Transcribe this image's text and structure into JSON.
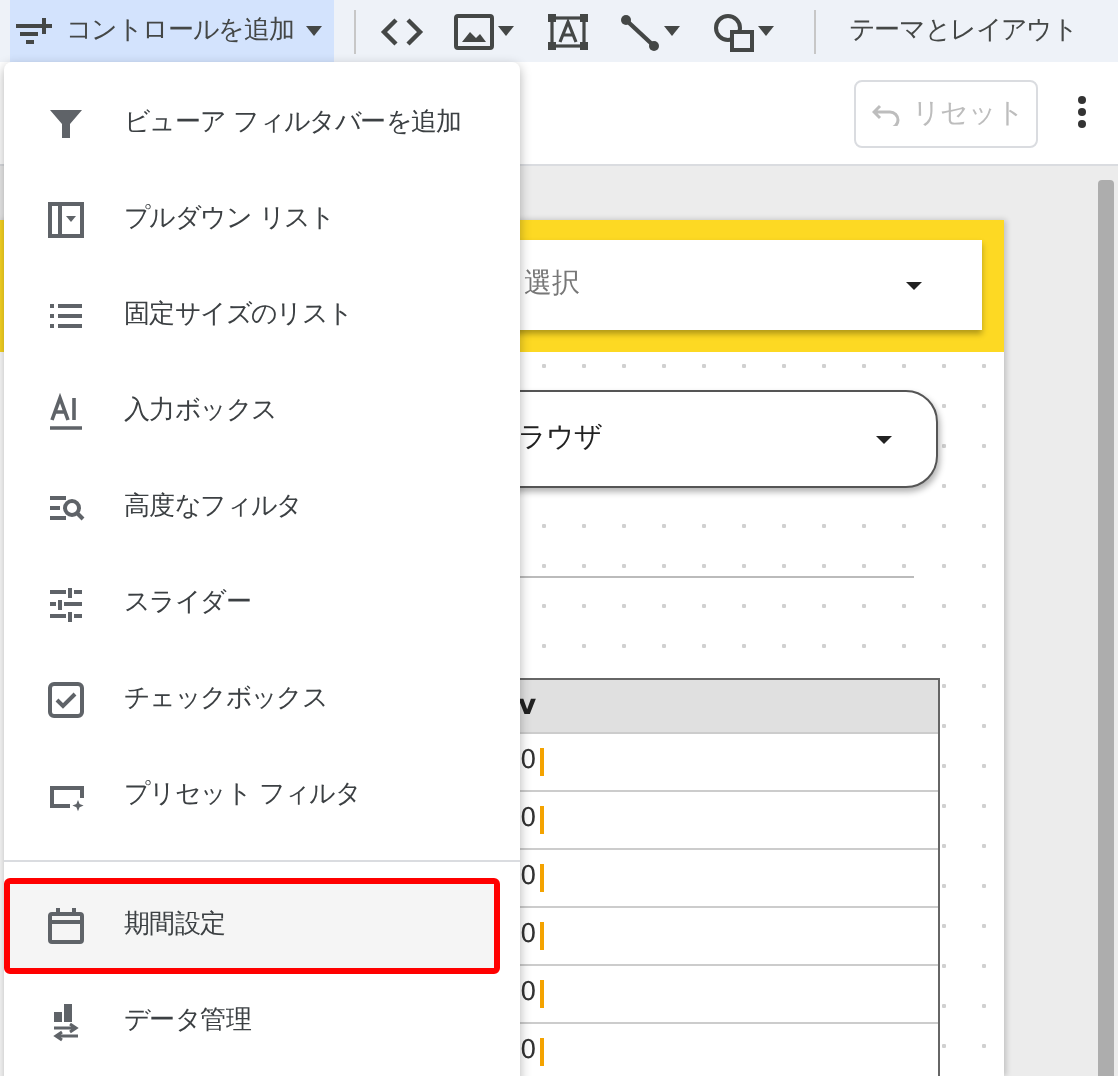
{
  "toolbar": {
    "add_control": {
      "label": "コントロールを追加",
      "selected": true
    },
    "tools": [
      {
        "kind": "code",
        "caret": false
      },
      {
        "kind": "image",
        "caret": true
      },
      {
        "kind": "textbox",
        "caret": false
      },
      {
        "kind": "line",
        "caret": true
      },
      {
        "kind": "shape",
        "caret": true
      }
    ],
    "theme_layout": "テーマとレイアウト"
  },
  "header": {
    "reset": {
      "label": "リセット",
      "disabled": true
    }
  },
  "canvas": {
    "filter_select": {
      "value": "選択"
    },
    "dropdown": {
      "value": "ラウザ"
    },
    "table": {
      "header": "v",
      "rows": [
        "0",
        "0",
        "0",
        "0",
        "0",
        "0"
      ]
    }
  },
  "menu": {
    "groups": [
      [
        {
          "kind": "filterbar",
          "label": "ビューア フィルタバーを追加",
          "highlighted": false
        },
        {
          "kind": "dropdown",
          "label": "プルダウン リスト",
          "highlighted": false
        },
        {
          "kind": "list",
          "label": "固定サイズのリスト",
          "highlighted": false
        },
        {
          "kind": "input",
          "label": "入力ボックス",
          "highlighted": false
        },
        {
          "kind": "advanced",
          "label": "高度なフィルタ",
          "highlighted": false
        },
        {
          "kind": "slider",
          "label": "スライダー",
          "highlighted": false
        },
        {
          "kind": "checkbox",
          "label": "チェックボックス",
          "highlighted": false
        },
        {
          "kind": "preset",
          "label": "プリセット フィルタ",
          "highlighted": false
        }
      ],
      [
        {
          "kind": "date",
          "label": "期間設定",
          "highlighted": true
        },
        {
          "kind": "data",
          "label": "データ管理",
          "highlighted": false
        }
      ]
    ]
  }
}
